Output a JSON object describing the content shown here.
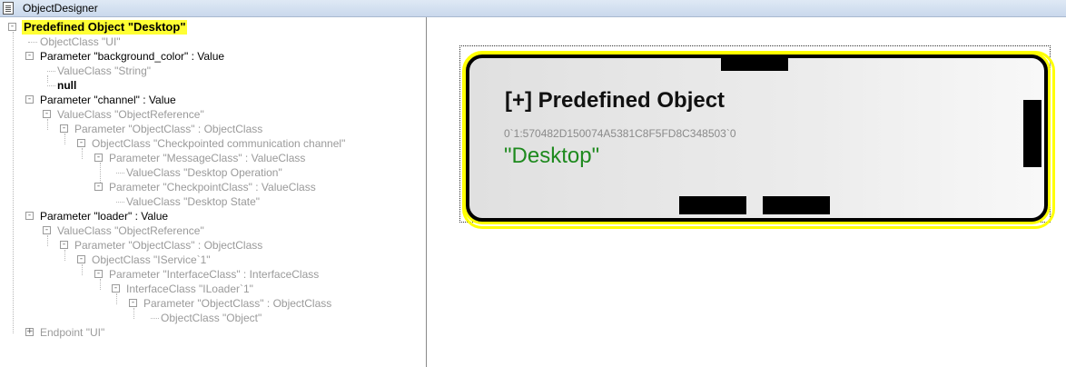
{
  "window": {
    "title": "ObjectDesigner"
  },
  "tree": {
    "nodes": [
      {
        "label": "Predefined Object \"Desktop\"",
        "style": "highlight",
        "expander": "-"
      },
      {
        "label": "ObjectClass \"UI\"",
        "style": "grey"
      },
      {
        "label": "Parameter \"background_color\" : Value",
        "style": "dark",
        "expander": "-"
      },
      {
        "label": "ValueClass \"String\"",
        "style": "grey"
      },
      {
        "label": "null",
        "style": "bold"
      },
      {
        "label": "Parameter \"channel\" : Value",
        "style": "dark",
        "expander": "-"
      },
      {
        "label": "ValueClass \"ObjectReference\"",
        "style": "grey",
        "expander": "-"
      },
      {
        "label": "Parameter \"ObjectClass\" : ObjectClass",
        "style": "grey",
        "expander": "-"
      },
      {
        "label": "ObjectClass \"Checkpointed communication channel\"",
        "style": "grey",
        "expander": "-"
      },
      {
        "label": "Parameter \"MessageClass\" : ValueClass",
        "style": "grey",
        "expander": "-"
      },
      {
        "label": "ValueClass \"Desktop Operation\"",
        "style": "grey"
      },
      {
        "label": "Parameter \"CheckpointClass\" : ValueClass",
        "style": "grey",
        "expander": "-"
      },
      {
        "label": "ValueClass \"Desktop State\"",
        "style": "grey"
      },
      {
        "label": "Parameter \"loader\" : Value",
        "style": "dark",
        "expander": "-"
      },
      {
        "label": "ValueClass \"ObjectReference\"",
        "style": "grey",
        "expander": "-"
      },
      {
        "label": "Parameter \"ObjectClass\" : ObjectClass",
        "style": "grey",
        "expander": "-"
      },
      {
        "label": "ObjectClass \"IService`1\"",
        "style": "grey",
        "expander": "-"
      },
      {
        "label": "Parameter \"InterfaceClass\" : InterfaceClass",
        "style": "grey",
        "expander": "-"
      },
      {
        "label": "InterfaceClass \"ILoader`1\"",
        "style": "grey",
        "expander": "-"
      },
      {
        "label": "Parameter \"ObjectClass\" : ObjectClass",
        "style": "grey",
        "expander": "-"
      },
      {
        "label": "ObjectClass \"Object\"",
        "style": "grey"
      },
      {
        "label": "Endpoint \"UI\"",
        "style": "grey",
        "expander": "+"
      }
    ]
  },
  "card": {
    "title": "[+] Predefined Object",
    "id": "0`1:570482D150074A5381C8F5FD8C348503`0",
    "name": "\"Desktop\"",
    "colors": {
      "border": "#000000",
      "highlight": "#ffff00",
      "name": "#1e8a1e"
    }
  }
}
